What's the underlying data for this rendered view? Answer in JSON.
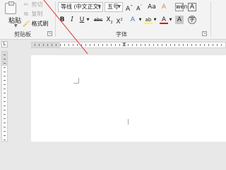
{
  "clipboard": {
    "paste_label": "粘贴",
    "cut_label": "剪切",
    "copy_label": "复制",
    "format_painter_label": "格式刷",
    "group_label": "剪贴板"
  },
  "font": {
    "font_name": "等线 (中文正文)",
    "font_size": "五号",
    "grow_label": "A",
    "shrink_label": "A",
    "case_label": "Aa",
    "clear_label": "A",
    "phonetic_label": "wén",
    "border_label": "A",
    "bold_label": "B",
    "italic_label": "I",
    "underline_label": "U",
    "strike_label": "abc",
    "subscript_label": "X",
    "superscript_label": "X",
    "effects_label": "A",
    "highlight_label": "ab",
    "color_label": "A",
    "shading_label": "A",
    "enclose_label": "字",
    "group_label": "字体"
  },
  "colors": {
    "highlight": "#ffff00",
    "font_color": "#e00000",
    "pointer": "#e05050"
  },
  "ruler": {
    "tab_marker": "L"
  }
}
